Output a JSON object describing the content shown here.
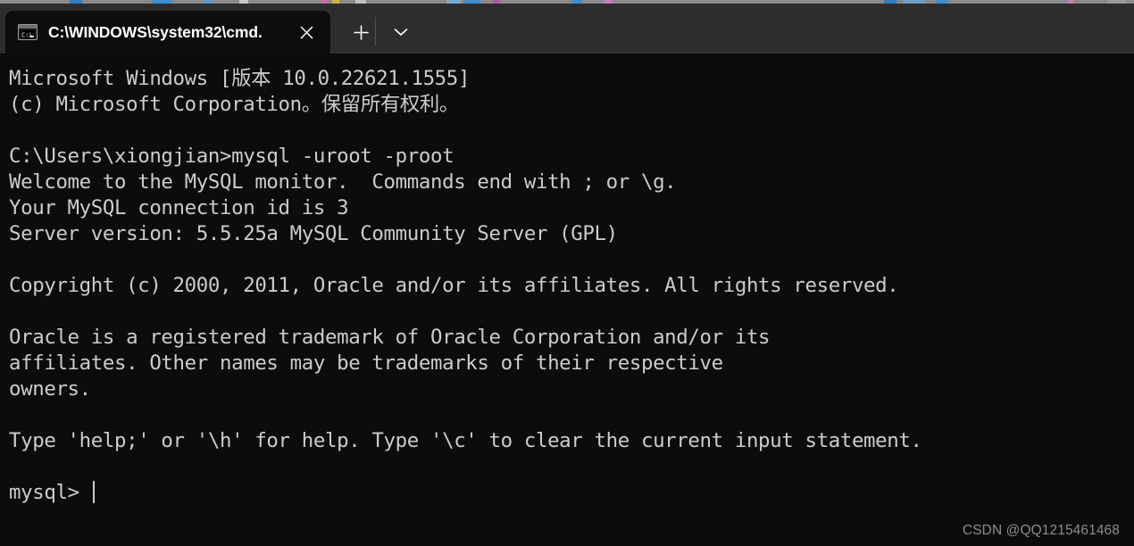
{
  "window": {
    "type": "windows-terminal",
    "background_color": "#0c0c0c",
    "titlebar_color": "#2d2d2d"
  },
  "titlebar": {
    "tab": {
      "icon_name": "cmd-console-icon",
      "title": "C:\\WINDOWS\\system32\\cmd.",
      "close_label": "✕",
      "active": true
    },
    "new_tab_label": "+",
    "dropdown_label": "⌄"
  },
  "terminal": {
    "text_color": "#cccccc",
    "prompt_cursor": "|",
    "lines": [
      "Microsoft Windows [版本 10.0.22621.1555]",
      "(c) Microsoft Corporation。保留所有权利。",
      "",
      "C:\\Users\\xiongjian>mysql -uroot -proot",
      "Welcome to the MySQL monitor.  Commands end with ; or \\g.",
      "Your MySQL connection id is 3",
      "Server version: 5.5.25a MySQL Community Server (GPL)",
      "",
      "Copyright (c) 2000, 2011, Oracle and/or its affiliates. All rights reserved.",
      "",
      "Oracle is a registered trademark of Oracle Corporation and/or its",
      "affiliates. Other names may be trademarks of their respective",
      "owners.",
      "",
      "Type 'help;' or '\\h' for help. Type '\\c' to clear the current input statement.",
      "",
      "mysql> "
    ],
    "prompt_line_index": 16
  },
  "watermark": {
    "text": "CSDN @QQ1215461468",
    "color": "#8c8c8c"
  }
}
